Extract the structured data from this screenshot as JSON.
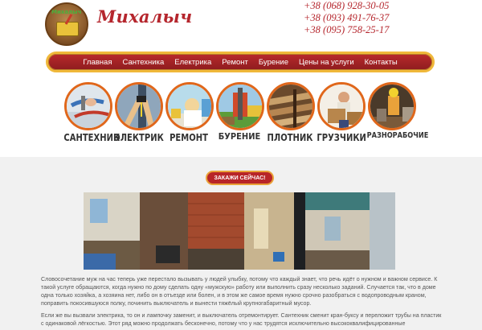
{
  "header": {
    "logo_icon": "toolbox-logo-icon",
    "logo_tag": "Михалыч",
    "brand_name": "Михалыч",
    "phones": [
      "+38 (068) 928-30-05",
      "+38 (093) 491-76-37",
      "+38 (095) 758-25-17"
    ]
  },
  "nav": {
    "items": [
      "Главная",
      "Сантехника",
      "Електрика",
      "Ремонт",
      "Бурение",
      "Цены на услуги",
      "Контакты"
    ],
    "accent": "#b5262d",
    "border": "#f0b83a"
  },
  "services": [
    {
      "label": "САНТЕХНИК",
      "icon": "plumber-icon"
    },
    {
      "label": "ЭЛЕКТРИК",
      "icon": "electrician-icon"
    },
    {
      "label": "РЕМОНТ",
      "icon": "repair-icon"
    },
    {
      "label": "БУРЕНИЕ",
      "icon": "drilling-icon"
    },
    {
      "label": "ПЛОТНИК",
      "icon": "carpenter-icon"
    },
    {
      "label": "ГРУЗЧИКИ",
      "icon": "movers-icon"
    },
    {
      "label": "РАЗНОРАБОЧИЕ",
      "icon": "handyman-icon"
    }
  ],
  "cta": {
    "label": "ЗАКАЖИ СЕЙЧАС!"
  },
  "content": {
    "p1": "Словосочетание муж на час теперь уже перестало вызывать у людей улыбку, потому что каждый знает, что речь идёт о нужном и важном сервисе. К такой услуге обращаются, когда нужно по дому сделать одну «мужскую» работу или выполнить сразу несколько заданий. Случается так, что в доме одна только хозяйка, а хозяина нет, либо он в отъезде или болен, и в этом же самое время нужно срочно разобраться с водопроводным краном, поправить покосившуюся полку, починить выключатель и вынести тяжёлый крупногабаритный мусор.",
    "p2": "Если же вы вызвали электрика, то он и лампочку заменит, и выключатель отремонтирует. Сантехник сменит кран-буксу и переложит трубы на пластик с одинаковой лёгкостью. Этот ряд можно продолжать бесконечно, потому что у нас трудятся исключительно высококвалифицированные"
  }
}
